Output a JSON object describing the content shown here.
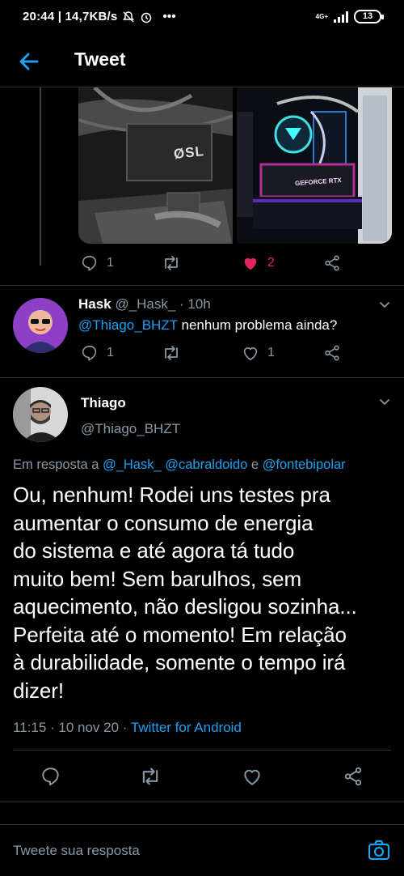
{
  "status_bar": {
    "time_speed": "20:44 | 14,7KB/s",
    "network": "4G+",
    "battery": "13"
  },
  "header": {
    "title": "Tweet"
  },
  "parent_tweet": {
    "image1_text": "ØSL",
    "image2_text": "GEFORCE RTX",
    "reply_count": "1",
    "like_count": "2"
  },
  "reply_hask": {
    "name": "Hask",
    "handle_time": "@_Hask_ · 10h",
    "mention": "@Thiago_BHZT",
    "text": " nenhum problema ainda?",
    "reply_count": "1",
    "like_count": "1"
  },
  "main_tweet": {
    "name": "Thiago",
    "handle": "@Thiago_BHZT",
    "replying_prefix": "Em resposta a ",
    "replying_mentions": "@_Hask_ @cabraldoido",
    "replying_and": " e ",
    "replying_last": "@fontebipolar",
    "text_lines": [
      "Ou, nenhum! Rodei uns testes pra",
      "aumentar o consumo de energia",
      "do sistema e até agora tá tudo",
      "muito bem! Sem barulhos, sem",
      "aquecimento, não desligou sozinha...",
      "Perfeita até o momento! Em relação",
      "à durabilidade, somente o tempo irá",
      "dizer!"
    ],
    "timestamp": "11:15 · 10 nov 20 · ",
    "source": "Twitter for Android"
  },
  "compose": {
    "placeholder": "Tweete sua resposta"
  },
  "colors": {
    "accent": "#1da1f2",
    "muted": "#8899a6",
    "like": "#e0245e",
    "border": "#2f3336"
  }
}
